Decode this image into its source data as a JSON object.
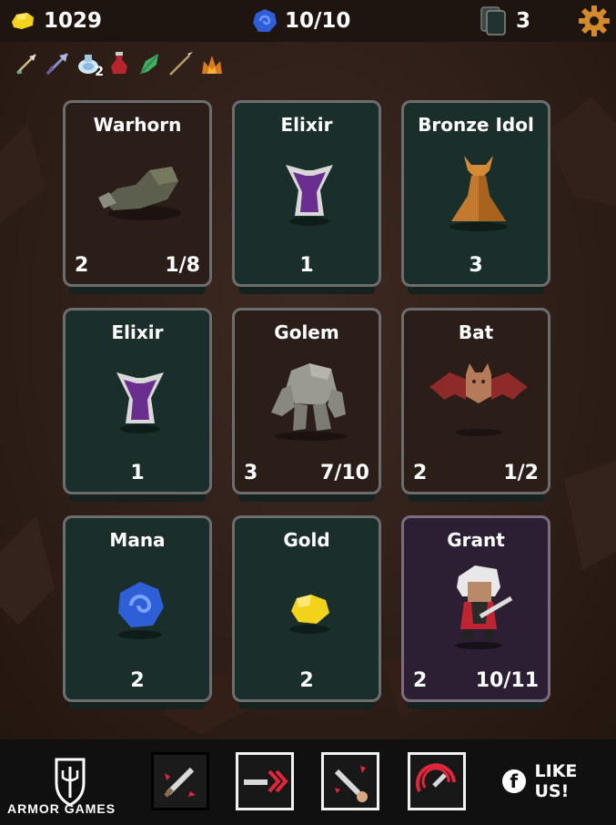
{
  "header": {
    "gold": "1029",
    "mana": "10/10",
    "deck": "3",
    "gold_icon": "gold-nugget-icon",
    "mana_icon": "mana-orb-icon",
    "deck_icon": "card-deck-icon",
    "settings_icon": "gear-icon"
  },
  "inventory": {
    "items": [
      {
        "icon": "arrow-icon"
      },
      {
        "icon": "crossbow-bolt-icon"
      },
      {
        "icon": "frost-flask-icon",
        "qty": "2"
      },
      {
        "icon": "red-potion-icon"
      },
      {
        "icon": "green-leaf-icon"
      },
      {
        "icon": "spear-icon"
      },
      {
        "icon": "fire-crown-icon"
      }
    ]
  },
  "cards": [
    {
      "name": "Warhorn",
      "left": "2",
      "center": "",
      "right": "1/8",
      "kind": "brown"
    },
    {
      "name": "Elixir",
      "left": "",
      "center": "1",
      "right": "",
      "kind": "teal"
    },
    {
      "name": "Bronze Idol",
      "left": "",
      "center": "3",
      "right": "",
      "kind": "teal"
    },
    {
      "name": "Elixir",
      "left": "",
      "center": "1",
      "right": "",
      "kind": "teal"
    },
    {
      "name": "Golem",
      "left": "3",
      "center": "",
      "right": "7/10",
      "kind": "brown"
    },
    {
      "name": "Bat",
      "left": "2",
      "center": "",
      "right": "1/2",
      "kind": "brown"
    },
    {
      "name": "Mana",
      "left": "",
      "center": "2",
      "right": "",
      "kind": "teal"
    },
    {
      "name": "Gold",
      "left": "",
      "center": "2",
      "right": "",
      "kind": "teal"
    },
    {
      "name": "Grant",
      "left": "2",
      "center": "",
      "right": "10/11",
      "kind": "purple"
    }
  ],
  "footer": {
    "brand": "ARMOR GAMES",
    "like": "LIKE US!",
    "fb_letter": "f",
    "skills": [
      {
        "icon": "sword-strike-icon"
      },
      {
        "icon": "sword-dash-icon"
      },
      {
        "icon": "sword-hand-icon"
      },
      {
        "icon": "sword-spin-icon"
      }
    ]
  },
  "colors": {
    "gold": "#f2d21a",
    "mana": "#2f5fd6",
    "card_brown": "#2b1e19",
    "card_teal": "#1a2f2b",
    "card_purple": "#2c1f33",
    "accent_red": "#e0263b"
  }
}
